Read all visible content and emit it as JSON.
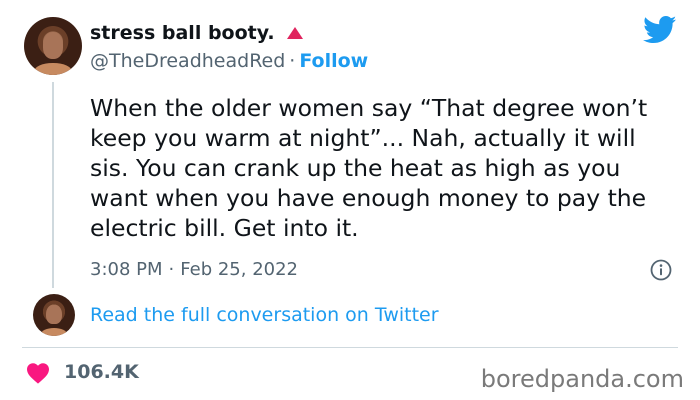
{
  "author": {
    "display_name": "stress ball booty.",
    "handle": "@TheDreadheadRed",
    "separator": "·",
    "follow_label": "Follow"
  },
  "tweet": {
    "text": "When the older women say “That degree won’t keep you warm at night”... Nah, actually it will sis. You can crank up the heat as high as you want when you have enough money to pay the electric bill. Get into it.",
    "time": "3:08 PM",
    "separator": "·",
    "date": "Feb 25, 2022"
  },
  "conversation_link": "Read the full conversation on Twitter",
  "likes": "106.4K",
  "watermark": "boredpanda.com",
  "icons": {
    "brand": "twitter-bird-icon",
    "info": "info-icon",
    "like": "heart-icon",
    "badge": "red-triangle-icon"
  },
  "colors": {
    "link": "#1d9bf0",
    "heart": "#f91880",
    "badge": "#e0245e",
    "muted": "#536471"
  }
}
